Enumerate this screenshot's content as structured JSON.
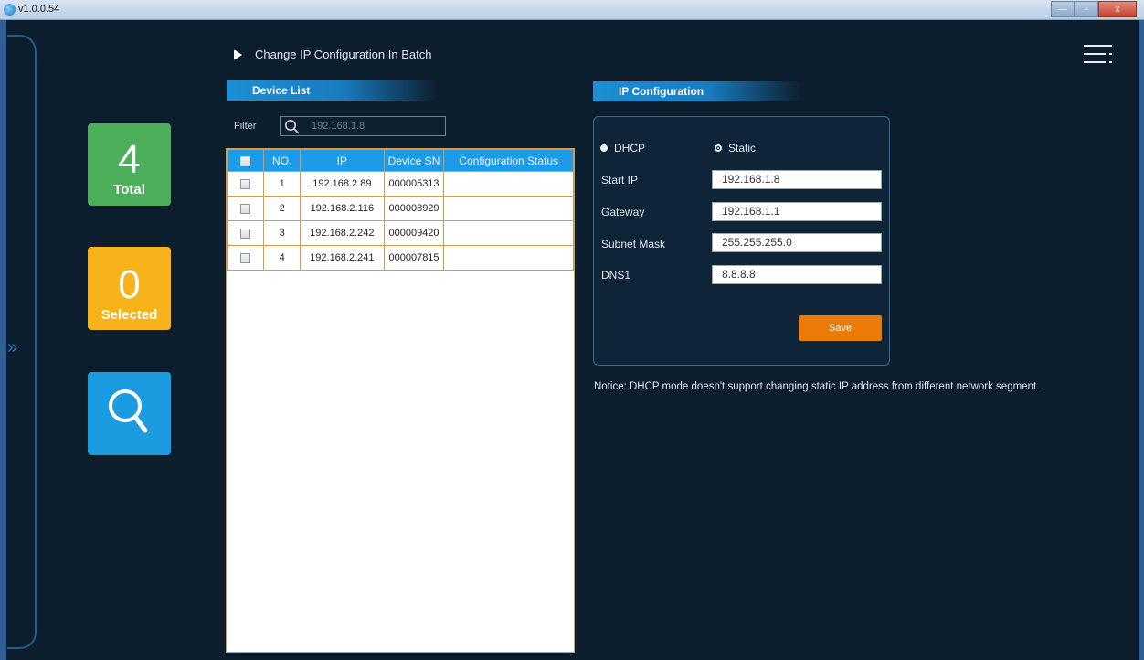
{
  "window": {
    "title": "v1.0.0.54",
    "minimize_label": "—",
    "maximize_label": "▫",
    "close_label": "x"
  },
  "sidebar": {
    "expand_label": "»"
  },
  "header": {
    "title": "Change IP Configuration In Batch"
  },
  "tiles": {
    "total": {
      "value": "4",
      "label": "Total"
    },
    "selected": {
      "value": "0",
      "label": "Selected"
    }
  },
  "device_list": {
    "section_title": "Device List",
    "filter_label": "Filter",
    "filter_value": "192.168.1.8",
    "columns": [
      "NO.",
      "IP",
      "Device SN",
      "Configuration Status"
    ],
    "rows": [
      {
        "no": "1",
        "ip": "192.168.2.89",
        "sn": "000005313",
        "status": ""
      },
      {
        "no": "2",
        "ip": "192.168.2.116",
        "sn": "000008929",
        "status": ""
      },
      {
        "no": "3",
        "ip": "192.168.2.242",
        "sn": "000009420",
        "status": ""
      },
      {
        "no": "4",
        "ip": "192.168.2.241",
        "sn": "000007815",
        "status": ""
      }
    ]
  },
  "ip_config": {
    "section_title": "IP Configuration",
    "mode_dhcp": "DHCP",
    "mode_static": "Static",
    "selected_mode": "Static",
    "start_ip_label": "Start IP",
    "start_ip": "192.168.1.8",
    "gateway_label": "Gateway",
    "gateway": "192.168.1.1",
    "subnet_label": "Subnet Mask",
    "subnet": "255.255.255.0",
    "dns_label": "DNS1",
    "dns": "8.8.8.8",
    "save_label": "Save",
    "notice": "Notice: DHCP mode doesn't support changing static IP address from different network segment."
  },
  "colors": {
    "background": "#0c1d2d",
    "accent_blue": "#1d9be6",
    "tile_total": "#4cae5b",
    "tile_selected": "#f8b31b",
    "tile_search": "#1b9be0",
    "save_button": "#ec7a08",
    "table_border": "#d59a4a"
  }
}
